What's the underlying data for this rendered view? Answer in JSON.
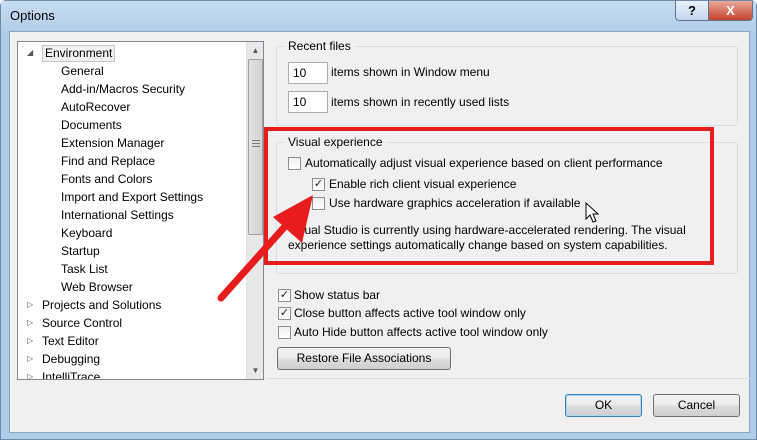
{
  "window": {
    "title": "Options",
    "help_glyph": "?",
    "close_glyph": "X"
  },
  "tree": {
    "expander_expanded": "◢",
    "expander_collapsed": "▷",
    "items": [
      {
        "label": "Environment",
        "level": 0,
        "expanded": true,
        "selected": true
      },
      {
        "label": "General",
        "level": 1
      },
      {
        "label": "Add-in/Macros Security",
        "level": 1
      },
      {
        "label": "AutoRecover",
        "level": 1
      },
      {
        "label": "Documents",
        "level": 1
      },
      {
        "label": "Extension Manager",
        "level": 1
      },
      {
        "label": "Find and Replace",
        "level": 1
      },
      {
        "label": "Fonts and Colors",
        "level": 1
      },
      {
        "label": "Import and Export Settings",
        "level": 1
      },
      {
        "label": "International Settings",
        "level": 1
      },
      {
        "label": "Keyboard",
        "level": 1
      },
      {
        "label": "Startup",
        "level": 1
      },
      {
        "label": "Task List",
        "level": 1
      },
      {
        "label": "Web Browser",
        "level": 1
      },
      {
        "label": "Projects and Solutions",
        "level": 0,
        "expanded": false
      },
      {
        "label": "Source Control",
        "level": 0,
        "expanded": false
      },
      {
        "label": "Text Editor",
        "level": 0,
        "expanded": false
      },
      {
        "label": "Debugging",
        "level": 0,
        "expanded": false
      },
      {
        "label": "IntelliTrace",
        "level": 0,
        "expanded": false
      }
    ],
    "scroll_up": "▲",
    "scroll_down": "▼"
  },
  "recent_files": {
    "heading": "Recent files",
    "window_menu_value": "10",
    "window_menu_label": "items shown in Window menu",
    "recent_lists_value": "10",
    "recent_lists_label": "items shown in recently used lists"
  },
  "visual": {
    "heading": "Visual experience",
    "auto_adjust_label": "Automatically adjust visual experience based on client performance",
    "auto_adjust_checked": false,
    "rich_client_label": "Enable rich client visual experience",
    "rich_client_checked": true,
    "hw_accel_label": "Use hardware graphics acceleration if available",
    "hw_accel_checked": false,
    "info_line1": "Visual Studio is currently using hardware-accelerated rendering. The visual",
    "info_line2": "experience settings automatically change based on system capabilities."
  },
  "options": {
    "status_bar_label": "Show status bar",
    "status_bar_checked": true,
    "close_button_label": "Close button affects active tool window only",
    "close_button_checked": true,
    "auto_hide_label": "Auto Hide button affects active tool window only",
    "auto_hide_checked": false,
    "restore_button_label": "Restore File Associations"
  },
  "footer": {
    "ok_label": "OK",
    "cancel_label": "Cancel"
  },
  "check_glyph": "✓",
  "colors": {
    "annotation_red": "#e81c1c",
    "window_frame": "#aecde9"
  }
}
